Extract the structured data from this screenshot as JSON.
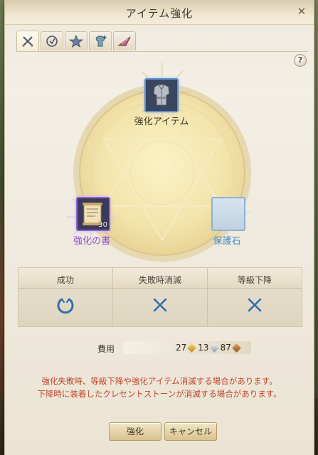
{
  "window": {
    "title": "アイテム強化",
    "close_symbol": "✕",
    "help_symbol": "?"
  },
  "tabs": [
    {
      "icon": "crossed-swords-icon",
      "active": true
    },
    {
      "icon": "shield-icon",
      "active": false
    },
    {
      "icon": "star-emblem-icon",
      "active": false
    },
    {
      "icon": "armor-plus-icon",
      "active": false
    },
    {
      "icon": "wing-icon",
      "active": false
    }
  ],
  "slots": {
    "target": {
      "label": "強化アイテム",
      "icon": "armor-item-icon"
    },
    "scroll": {
      "label": "強化の書",
      "count": "30",
      "icon": "scroll-icon"
    },
    "protect": {
      "label": "保護石",
      "icon": "empty-slot"
    }
  },
  "results": {
    "headers": [
      "成功",
      "失敗時消滅",
      "等級下降"
    ],
    "icons": [
      "success-ring-icon",
      "cross-icon",
      "cross-icon"
    ]
  },
  "cost": {
    "label": "費用",
    "gold": "27",
    "silver": "13",
    "bronze": "87"
  },
  "warnings": [
    "強化失敗時、等級下降や強化アイテム消滅する場合があります。",
    "下降時に装着したクレセントストーンが消滅する場合があります。"
  ],
  "buttons": {
    "enhance": "強化",
    "cancel": "キャンセル"
  },
  "colors": {
    "accent_blue": "#2f6db0",
    "scroll_label": "#8a4ed0",
    "protect_label": "#4c8fc4",
    "warning": "#c2432d"
  }
}
